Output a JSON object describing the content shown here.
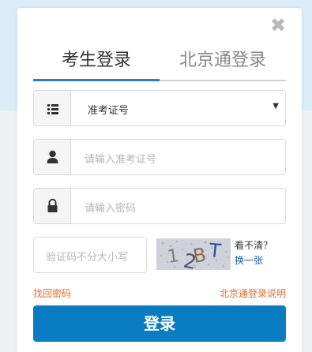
{
  "tabs": {
    "exam_login": "考生登录",
    "beijing_login": "北京通登录"
  },
  "form": {
    "id_type": {
      "selected": "准考证号"
    },
    "username": {
      "placeholder": "请输入准考证号"
    },
    "password": {
      "placeholder": "请输入密码"
    },
    "captcha": {
      "placeholder": "验证码不分大小写",
      "image_text": "12BT",
      "unclear_text": "看不清？",
      "refresh_text": "换一张"
    }
  },
  "links": {
    "retrieve_password": "找回密码",
    "beijing_login_help": "北京通登录说明"
  },
  "buttons": {
    "login": "登录",
    "close": "✖"
  },
  "colors": {
    "accent": "#0a7cc1",
    "link": "#e36a32"
  }
}
